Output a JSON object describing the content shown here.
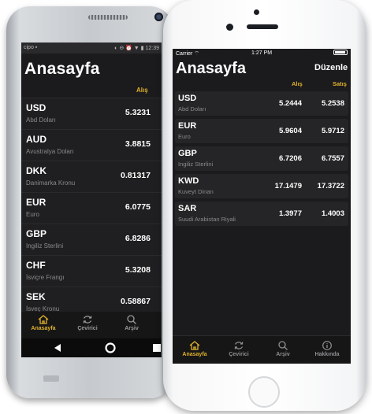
{
  "android": {
    "status": {
      "left": "cipo ▪",
      "right": "◐ ⊖ ⏰ ▼ ▮ 12:39"
    },
    "title": "Anasayfa",
    "column_header": "Alış",
    "rows": [
      {
        "code": "USD",
        "name": "Abd Doları",
        "value": "5.3231"
      },
      {
        "code": "AUD",
        "name": "Avustralya Doları",
        "value": "3.8815"
      },
      {
        "code": "DKK",
        "name": "Danimarka Kronu",
        "value": "0.81317"
      },
      {
        "code": "EUR",
        "name": "Euro",
        "value": "6.0775"
      },
      {
        "code": "GBP",
        "name": "Ingiliz Sterlini",
        "value": "6.8286"
      },
      {
        "code": "CHF",
        "name": "İsviçre Frangı",
        "value": "5.3208"
      },
      {
        "code": "SEK",
        "name": "İsveç Kronu",
        "value": "0.58867"
      }
    ],
    "tabs": [
      {
        "label": "Anasayfa",
        "icon": "home-icon"
      },
      {
        "label": "Çevirici",
        "icon": "refresh-icon"
      },
      {
        "label": "Arşiv",
        "icon": "search-icon"
      }
    ]
  },
  "ios": {
    "status": {
      "carrier": "Carrier ⌔",
      "time": "1:27 PM"
    },
    "title": "Anasayfa",
    "edit_label": "Düzenle",
    "buy_header": "Alış",
    "sell_header": "Satış",
    "rows": [
      {
        "code": "USD",
        "name": "Abd Doları",
        "buy": "5.2444",
        "sell": "5.2538"
      },
      {
        "code": "EUR",
        "name": "Euro",
        "buy": "5.9604",
        "sell": "5.9712"
      },
      {
        "code": "GBP",
        "name": "Ingiliz Sterlini",
        "buy": "6.7206",
        "sell": "6.7557"
      },
      {
        "code": "KWD",
        "name": "Kuveyt Dinarı",
        "buy": "17.1479",
        "sell": "17.3722"
      },
      {
        "code": "SAR",
        "name": "Suudi Arabistan Riyali",
        "buy": "1.3977",
        "sell": "1.4003"
      }
    ],
    "tabs": [
      {
        "label": "Anasayfa",
        "icon": "home-icon"
      },
      {
        "label": "Çevirici",
        "icon": "refresh-icon"
      },
      {
        "label": "Arşiv",
        "icon": "search-icon"
      },
      {
        "label": "Hakkında",
        "icon": "info-icon"
      }
    ]
  },
  "colors": {
    "accent": "#e0b12a",
    "screen_bg": "#1b1b1d",
    "row_bg": "#252527"
  }
}
